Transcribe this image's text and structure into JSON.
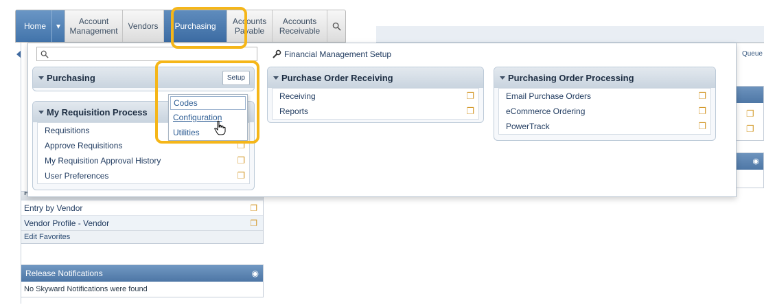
{
  "nav": {
    "home": "Home",
    "items": [
      {
        "line1": "Account",
        "line2": "Management"
      },
      {
        "line1": "Vendors",
        "line2": ""
      },
      {
        "line1": "Purchasing",
        "line2": ""
      },
      {
        "line1": "Accounts",
        "line2": "Payable"
      },
      {
        "line1": "Accounts",
        "line2": "Receivable"
      }
    ]
  },
  "top_strip_right": "Queue",
  "dropdown": {
    "search_placeholder": "",
    "fm_setup": "Financial Management Setup",
    "purchasing": {
      "title": "Purchasing",
      "setup_button": "Setup"
    },
    "setup_menu": [
      "Codes",
      "Configuration",
      "Utilities"
    ],
    "my_requisition": {
      "title": "My Requisition Process",
      "items": [
        "Requisitions",
        "Approve Requisitions",
        "My Requisition Approval History",
        "User Preferences"
      ]
    },
    "po_receiving": {
      "title": "Purchase Order Receiving",
      "items": [
        "Receiving",
        "Reports"
      ]
    },
    "po_processing": {
      "title": "Purchasing Order Processing",
      "items": [
        "Email Purchase Orders",
        "eCommerce Ordering",
        "PowerTrack"
      ]
    }
  },
  "favorites": {
    "header_partial": "Financial Management",
    "items": [
      "Entry by Vendor",
      "Vendor Profile - Vendor"
    ],
    "footer": "Edit Favorites"
  },
  "release": {
    "title": "Release Notifications",
    "message": "No Skyward Notifications were found"
  },
  "colors": {
    "highlight": "#f5b619",
    "nav_active": "#4a78ac"
  }
}
